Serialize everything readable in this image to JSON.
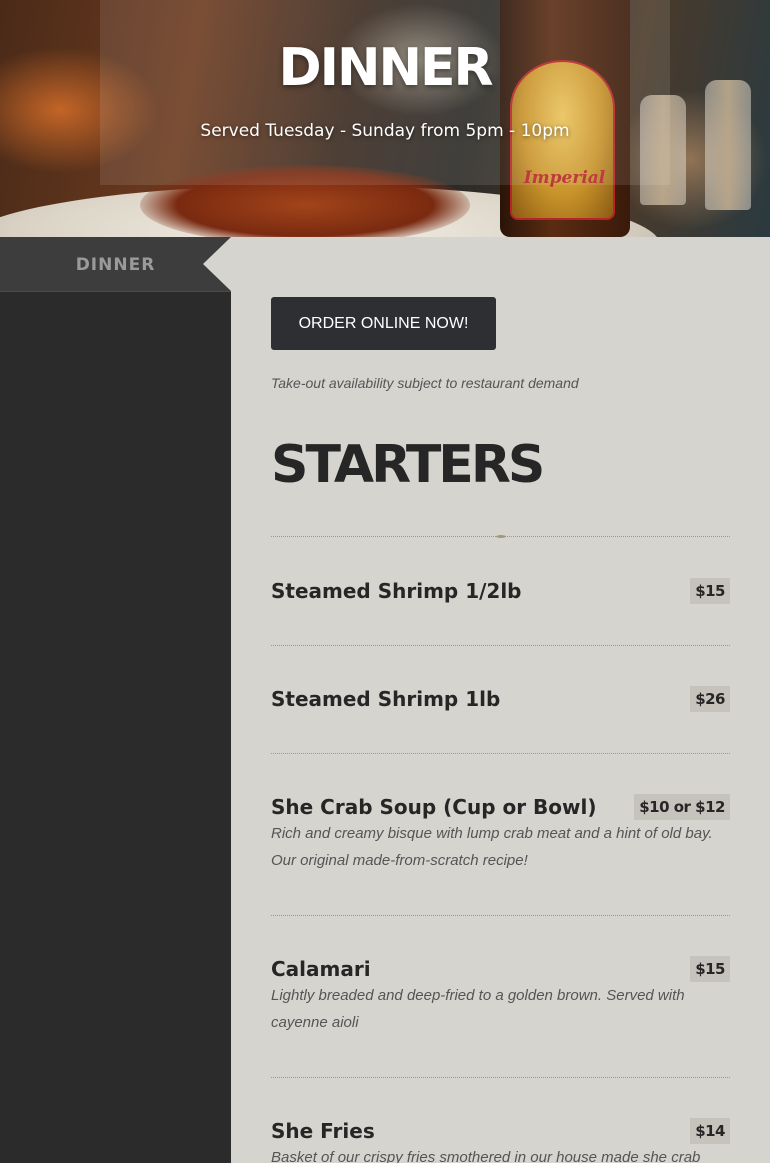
{
  "hero": {
    "title": "DINNER",
    "subtitle": "Served Tuesday - Sunday from 5pm - 10pm",
    "bottle_label": "Imperial"
  },
  "sidebar": {
    "tabs": [
      {
        "label": "DINNER"
      }
    ]
  },
  "main": {
    "order_button": "ORDER ONLINE NOW!",
    "takeout_note": "Take-out availability subject to restaurant demand",
    "section_heading": "STARTERS",
    "items": [
      {
        "name": "Steamed Shrimp 1/2lb",
        "price": "$15",
        "description": ""
      },
      {
        "name": "Steamed Shrimp 1lb",
        "price": "$26",
        "description": ""
      },
      {
        "name": "She Crab Soup (Cup or Bowl)",
        "price": "$10 or $12",
        "description": "Rich and creamy bisque with lump crab meat and a hint of old bay. Our original made-from-scratch recipe!"
      },
      {
        "name": "Calamari",
        "price": "$15",
        "description": "Lightly breaded and deep-fried to a golden brown.  Served with cayenne aioli"
      },
      {
        "name": "She Fries",
        "price": "$14",
        "description": "Basket of our crispy fries smothered in our house made she crab"
      }
    ]
  },
  "colors": {
    "sidebar_bg": "#2b2b2b",
    "sidebar_tab_bg": "#3d3d3d",
    "main_bg": "#d6d4cf",
    "button_bg": "#2d2f32",
    "price_badge_bg": "#c6c3bc",
    "heading_text": "#262626"
  }
}
